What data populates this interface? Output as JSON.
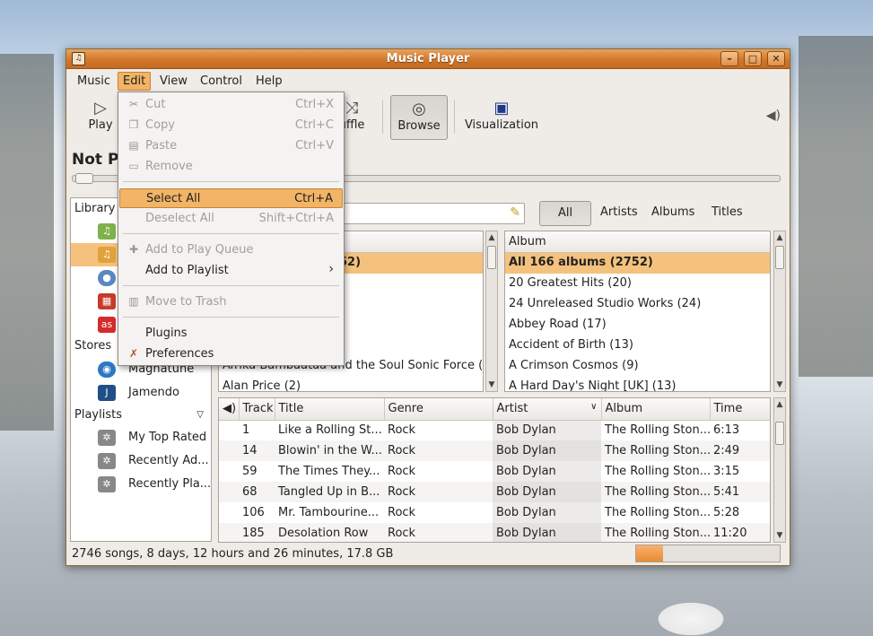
{
  "window": {
    "title": "Music Player"
  },
  "menubar": {
    "music": "Music",
    "edit": "Edit",
    "view": "View",
    "control": "Control",
    "help": "Help"
  },
  "toolbar": {
    "play": "Play",
    "shuffle": "uffle",
    "browse": "Browse",
    "visualization": "Visualization"
  },
  "now_playing": "Not P",
  "sidebar": {
    "library_header": "Library",
    "stores_header": "Stores",
    "playlists_header": "Playlists",
    "stores": [
      "Magnatune",
      "Jamendo"
    ],
    "playlists": [
      "My Top Rated",
      "Recently Ad...",
      "Recently Pla..."
    ]
  },
  "filters": {
    "all": "All",
    "artists": "Artists",
    "albums": "Albums",
    "titles": "Titles"
  },
  "artist_pane": {
    "first_row": "52)",
    "rows_partial": [
      "Afrika Bambaataa and the Soul Sonic Force (",
      "Alan Price (2)"
    ]
  },
  "album_pane": {
    "header": "Album",
    "rows": [
      "All 166 albums (2752)",
      "20 Greatest Hits (20)",
      "24 Unreleased Studio Works (24)",
      "Abbey Road (17)",
      "Accident of Birth (13)",
      "A Crimson Cosmos (9)",
      "A Hard Day's Night [UK] (13)"
    ]
  },
  "tracks": {
    "columns": [
      "Track",
      "Title",
      "Genre",
      "Artist",
      "Album",
      "Time"
    ],
    "rows": [
      [
        "1",
        "Like a Rolling St...",
        "Rock",
        "Bob Dylan",
        "The Rolling Ston...",
        "6:13"
      ],
      [
        "14",
        "Blowin' in the W...",
        "Rock",
        "Bob Dylan",
        "The Rolling Ston...",
        "2:49"
      ],
      [
        "59",
        "The Times They...",
        "Rock",
        "Bob Dylan",
        "The Rolling Ston...",
        "3:15"
      ],
      [
        "68",
        "Tangled Up in B...",
        "Rock",
        "Bob Dylan",
        "The Rolling Ston...",
        "5:41"
      ],
      [
        "106",
        "Mr. Tambourine...",
        "Rock",
        "Bob Dylan",
        "The Rolling Ston...",
        "5:28"
      ],
      [
        "185",
        "Desolation Row",
        "Rock",
        "Bob Dylan",
        "The Rolling Ston...",
        "11:20"
      ]
    ]
  },
  "status": {
    "text": "2746 songs, 8 days, 12 hours and 26 minutes, 17.8 GB",
    "progress_fraction": 0.19
  },
  "edit_menu": {
    "cut": "Cut",
    "cut_acc": "Ctrl+X",
    "copy": "Copy",
    "copy_acc": "Ctrl+C",
    "paste": "Paste",
    "paste_acc": "Ctrl+V",
    "remove": "Remove",
    "select_all": "Select All",
    "select_all_acc": "Ctrl+A",
    "deselect_all": "Deselect All",
    "deselect_all_acc": "Shift+Ctrl+A",
    "add_to_queue": "Add to Play Queue",
    "add_to_playlist": "Add to Playlist",
    "move_to_trash": "Move to Trash",
    "plugins": "Plugins",
    "preferences": "Preferences"
  },
  "colors": {
    "accent": "#f2b466",
    "selection": "#f5c27e",
    "titlebar": "#d2782c"
  }
}
